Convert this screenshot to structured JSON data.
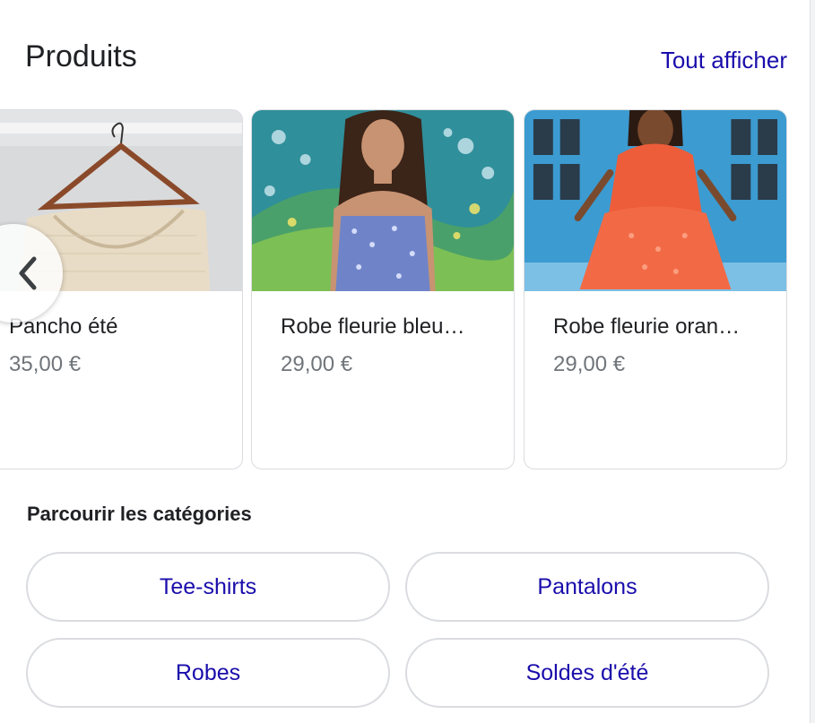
{
  "header": {
    "title": "Produits",
    "see_all_label": "Tout afficher"
  },
  "carousel": {
    "previous_icon": "chevron-left-icon",
    "products": [
      {
        "name": "Pancho été",
        "price": "35,00 €",
        "image": "beige knit sweater on wooden hanger"
      },
      {
        "name": "Robe fleurie bleu…",
        "price": "29,00 €",
        "image": "woman in blue floral dress in front of painted wall"
      },
      {
        "name": "Robe fleurie oran…",
        "price": "29,00 €",
        "image": "woman in orange floral dress in front of blue doors"
      }
    ]
  },
  "categories": {
    "title": "Parcourir les catégories",
    "items": [
      "Tee-shirts",
      "Pantalons",
      "Robes",
      "Soldes d'été"
    ]
  },
  "colors": {
    "link": "#1a0dab",
    "text": "#202124",
    "muted": "#70757a",
    "border": "#dadce0"
  }
}
